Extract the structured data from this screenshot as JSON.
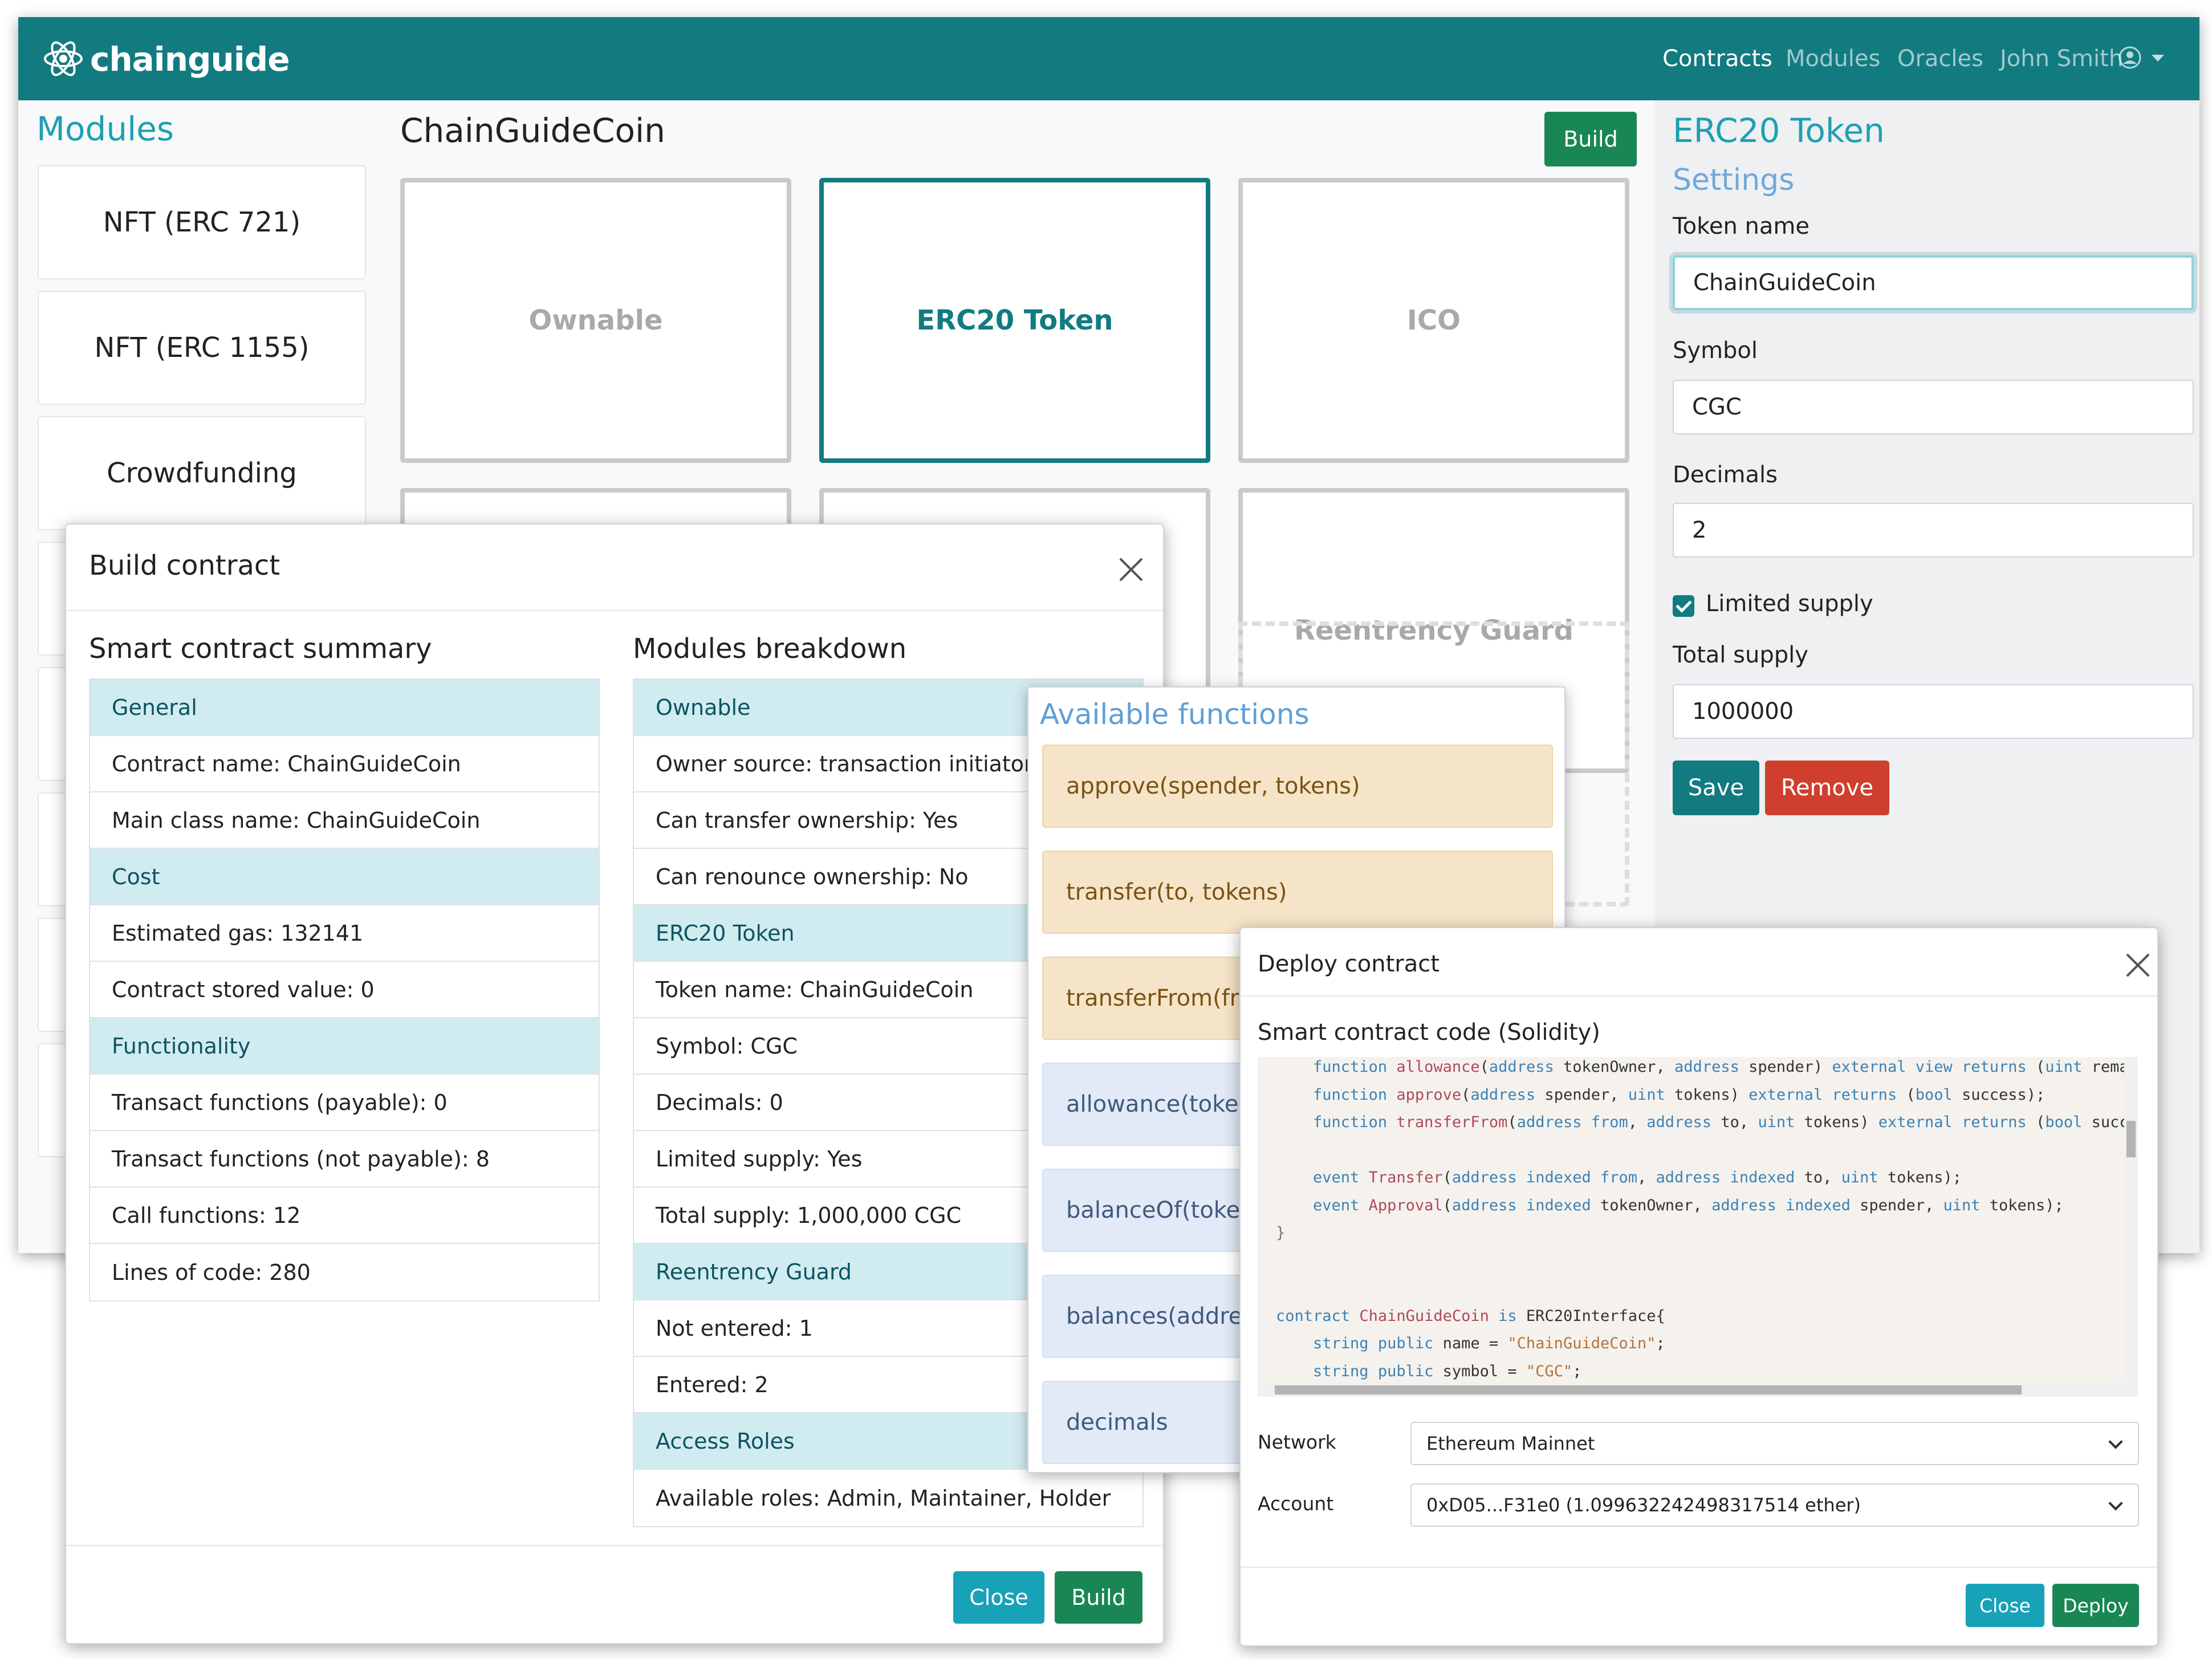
{
  "navbar": {
    "brand": "chainguide",
    "links": [
      "Contracts",
      "Modules",
      "Oracles"
    ],
    "user_name": "John Smith"
  },
  "modules_panel": {
    "title": "Modules",
    "items": [
      "NFT (ERC 721)",
      "NFT (ERC 1155)",
      "Crowdfunding"
    ]
  },
  "contract": {
    "title": "ChainGuideCoin",
    "build_label": "Build",
    "blocks": [
      "Ownable",
      "ERC20 Token",
      "ICO",
      "Reentrency Guard"
    ],
    "selected_block": "ERC20 Token"
  },
  "settings": {
    "title": "ERC20 Token",
    "subtitle": "Settings",
    "token_name_label": "Token name",
    "token_name_value": "ChainGuideCoin",
    "symbol_label": "Symbol",
    "symbol_value": "CGC",
    "decimals_label": "Decimals",
    "decimals_value": "2",
    "limited_supply_label": "Limited supply",
    "limited_supply_checked": true,
    "total_supply_label": "Total supply",
    "total_supply_value": "1000000",
    "save_label": "Save",
    "remove_label": "Remove"
  },
  "build_modal": {
    "title": "Build contract",
    "summary_heading": "Smart contract summary",
    "breakdown_heading": "Modules breakdown",
    "summary_rows": [
      {
        "text": "General",
        "head": true
      },
      {
        "text": "Contract name: ChainGuideCoin"
      },
      {
        "text": "Main class name: ChainGuideCoin"
      },
      {
        "text": "Cost",
        "head": true
      },
      {
        "text": "Estimated gas: 132141"
      },
      {
        "text": "Contract stored value: 0"
      },
      {
        "text": "Functionality",
        "head": true
      },
      {
        "text": "Transact functions (payable): 0"
      },
      {
        "text": "Transact functions (not payable): 8"
      },
      {
        "text": "Call functions: 12"
      },
      {
        "text": "Lines of code: 280"
      }
    ],
    "breakdown_rows": [
      {
        "text": "Ownable",
        "head": true
      },
      {
        "text": "Owner source: transaction initiator"
      },
      {
        "text": "Can transfer ownership: Yes"
      },
      {
        "text": "Can renounce ownership: No"
      },
      {
        "text": "ERC20 Token",
        "head": true
      },
      {
        "text": "Token name: ChainGuideCoin"
      },
      {
        "text": "Symbol: CGC"
      },
      {
        "text": "Decimals: 0"
      },
      {
        "text": "Limited supply: Yes"
      },
      {
        "text": "Total supply: 1,000,000 CGC"
      },
      {
        "text": "Reentrency Guard",
        "head": true
      },
      {
        "text": "Not entered: 1"
      },
      {
        "text": "Entered: 2"
      },
      {
        "text": "Access Roles",
        "head": true
      },
      {
        "text": "Available roles: Admin, Maintainer, Holder"
      }
    ],
    "close_label": "Close",
    "build_label": "Build"
  },
  "functions_panel": {
    "title": "Available functions",
    "items": [
      {
        "text": "approve(spender, tokens)",
        "kind": "write"
      },
      {
        "text": "transfer(to, tokens)",
        "kind": "write"
      },
      {
        "text": "transferFrom(from, to, tokens)",
        "kind": "write"
      },
      {
        "text": "allowance(tokenOwner, spender)",
        "kind": "read"
      },
      {
        "text": "balanceOf(tokenOwner)",
        "kind": "read"
      },
      {
        "text": "balances(address)",
        "kind": "read"
      },
      {
        "text": "decimals",
        "kind": "read"
      }
    ]
  },
  "deploy_modal": {
    "title": "Deploy contract",
    "code_heading": "Smart contract code (Solidity)",
    "network_label": "Network",
    "network_value": "Ethereum Mainnet",
    "account_label": "Account",
    "account_value": "0xD05...F31e0 (1.099632242498317514 ether)",
    "close_label": "Close",
    "deploy_label": "Deploy"
  },
  "colors": {
    "primary": "#127b80",
    "info": "#17a2b8",
    "success": "#198754",
    "danger": "#cf3f2e",
    "list_header": "#d1ecf0",
    "write_fn": "#f5e4c8",
    "read_fn": "#e2eaf7"
  }
}
